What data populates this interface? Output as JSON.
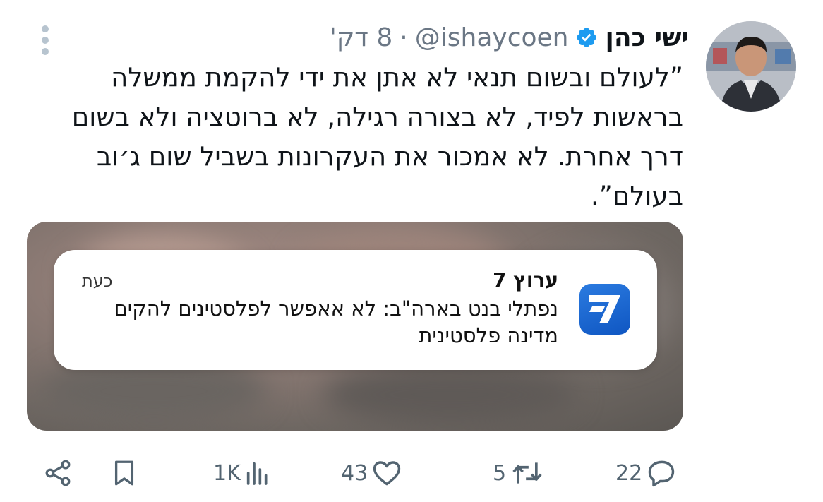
{
  "tweet": {
    "author_name": "ישי כהן",
    "handle": "@ishaycoen",
    "separator": "·",
    "time": "8 דק'",
    "text": "”לעולם ובשום תנאי לא אתן את ידי להקמת ממשלה בראשות לפיד, לא בצורה רגילה, לא ברוטציה ולא בשום דרך אחרת. לא אמכור את העקרונות בשביל שום ג׳וב בעולם”."
  },
  "notification": {
    "app_name": "ערוץ 7",
    "time": "כעת",
    "text": "נפתלי בנט בארה\"ב: לא אאפשר לפלסטינים להקים מדינה פלסטינית"
  },
  "actions": {
    "replies": "22",
    "retweets": "5",
    "likes": "43",
    "views": "1K"
  },
  "icons": [
    "more-vertical-icon",
    "verified-badge-icon",
    "reply-icon",
    "retweet-icon",
    "like-icon",
    "views-icon",
    "bookmark-icon",
    "share-icon"
  ],
  "colors": {
    "accent_blue": "#1d9bf0",
    "muted_text": "#536471",
    "app_icon_blue": "#1460cf"
  }
}
